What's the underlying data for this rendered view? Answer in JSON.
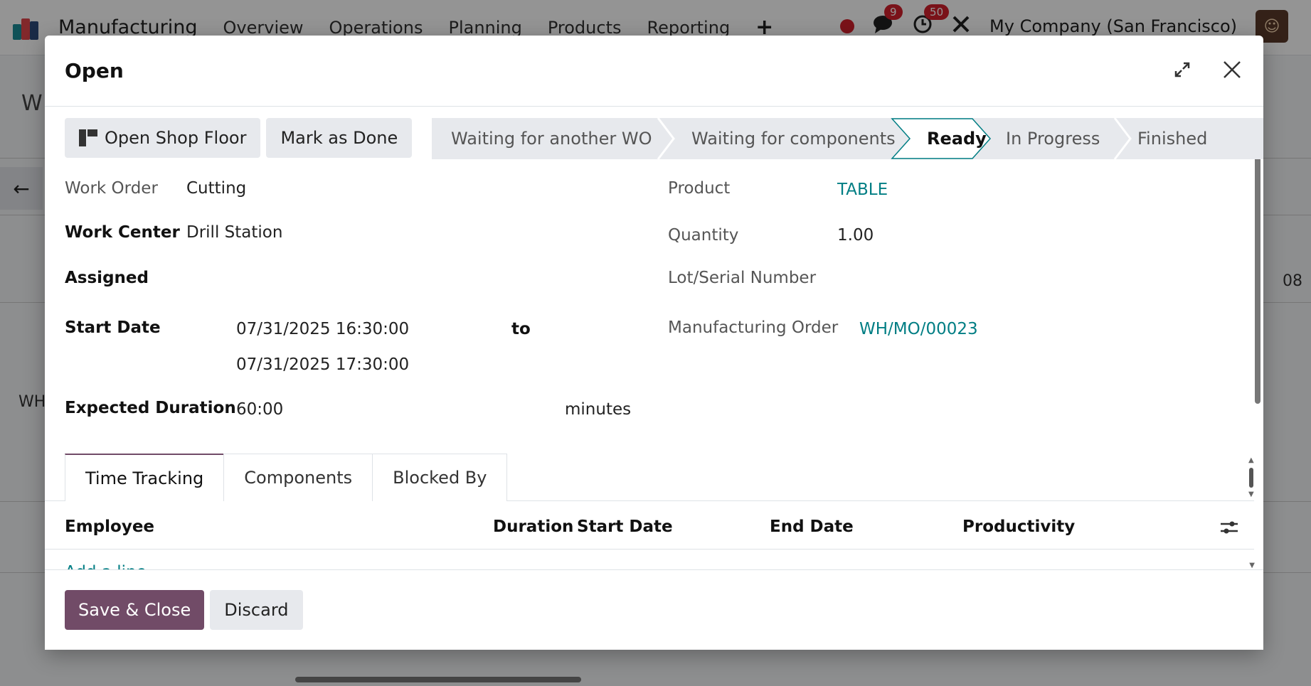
{
  "topbar": {
    "app_name": "Manufacturing",
    "menu": [
      "Overview",
      "Operations",
      "Planning",
      "Products",
      "Reporting"
    ],
    "plus": "+",
    "messages_count": "9",
    "activities_count": "50",
    "company": "My Company (San Francisco)"
  },
  "background": {
    "page_title_fragment": "W",
    "row_fragment": "WH",
    "col_fragment": "08"
  },
  "modal": {
    "title": "Open",
    "buttons": {
      "shop_floor": "Open Shop Floor",
      "mark_done": "Mark as Done"
    },
    "status_steps": [
      "Waiting for another WO",
      "Waiting for components",
      "Ready",
      "In Progress",
      "Finished"
    ],
    "active_status": "Ready",
    "fields": {
      "work_order_label": "Work Order",
      "work_order_value": "Cutting",
      "work_center_label": "Work Center",
      "work_center_value": "Drill Station",
      "assigned_label": "Assigned",
      "start_date_label": "Start Date",
      "start_date_value": "07/31/2025 16:30:00",
      "to_label": "to",
      "end_date_value": "07/31/2025 17:30:00",
      "expected_duration_label": "Expected Duration",
      "expected_duration_value": "60:00",
      "duration_unit": "minutes",
      "product_label": "Product",
      "product_value": "TABLE",
      "quantity_label": "Quantity",
      "quantity_value": "1.00",
      "lot_label": "Lot/Serial Number",
      "mo_label": "Manufacturing Order",
      "mo_value": "WH/MO/00023"
    },
    "tabs": [
      "Time Tracking",
      "Components",
      "Blocked By"
    ],
    "table_headers": [
      "Employee",
      "Duration",
      "Start Date",
      "End Date",
      "Productivity"
    ],
    "add_line": "Add a line",
    "footer": {
      "save": "Save & Close",
      "discard": "Discard"
    }
  },
  "colors": {
    "primary": "#714b67",
    "link": "#017e84",
    "badge": "#d21f2b"
  }
}
